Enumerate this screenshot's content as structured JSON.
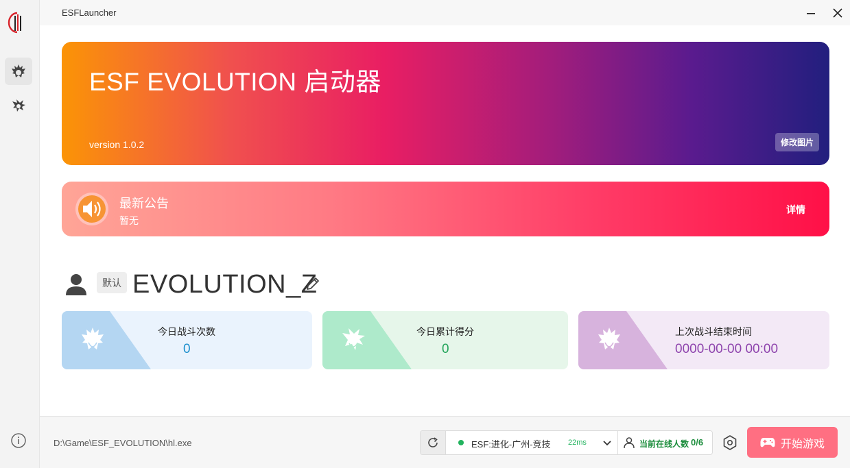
{
  "window": {
    "title": "ESFLauncher"
  },
  "banner": {
    "title": "ESF EVOLUTION 启动器",
    "version": "version 1.0.2",
    "change_image_label": "修改图片"
  },
  "notice": {
    "title": "最新公告",
    "subtitle": "暂无",
    "detail_label": "详情"
  },
  "user": {
    "badge": "默认",
    "name": "EVOLUTION_Z"
  },
  "stats": [
    {
      "label": "今日战斗次数",
      "value": "0",
      "color": "#1c8fcd"
    },
    {
      "label": "今日累计得分",
      "value": "0",
      "color": "#22a45a"
    },
    {
      "label": "上次战斗结束时间",
      "value": "0000-00-00 00:00",
      "color": "#8e44ad"
    }
  ],
  "footer": {
    "game_path": "D:\\Game\\ESF_EVOLUTION\\hl.exe",
    "server": {
      "name": "ESF:进化-广州-竞技",
      "ping": "22ms",
      "status_color": "#22b35e"
    },
    "online": {
      "label": "当前在线人数",
      "count": "0/6"
    },
    "start_label": "开始游戏"
  },
  "icons": {
    "sidebar": [
      "logo-icon",
      "flame-hair-icon",
      "spiky-hair-icon",
      "info-icon"
    ],
    "titlebar": [
      "minimize-icon",
      "close-icon"
    ]
  },
  "colors": {
    "start_button": "#ff6f82",
    "online_text": "#1e8e3e"
  }
}
